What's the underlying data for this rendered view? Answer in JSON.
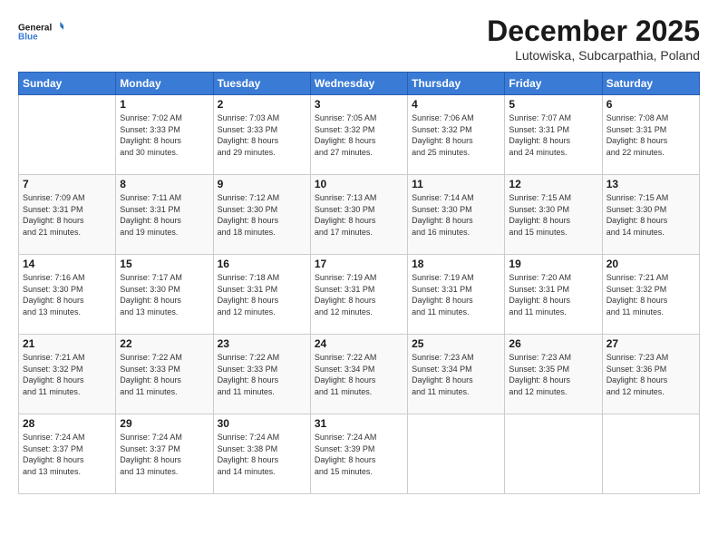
{
  "header": {
    "logo_line1": "General",
    "logo_line2": "Blue",
    "month_title": "December 2025",
    "location": "Lutowiska, Subcarpathia, Poland"
  },
  "days_of_week": [
    "Sunday",
    "Monday",
    "Tuesday",
    "Wednesday",
    "Thursday",
    "Friday",
    "Saturday"
  ],
  "weeks": [
    [
      {
        "day": "",
        "info": ""
      },
      {
        "day": "1",
        "info": "Sunrise: 7:02 AM\nSunset: 3:33 PM\nDaylight: 8 hours\nand 30 minutes."
      },
      {
        "day": "2",
        "info": "Sunrise: 7:03 AM\nSunset: 3:33 PM\nDaylight: 8 hours\nand 29 minutes."
      },
      {
        "day": "3",
        "info": "Sunrise: 7:05 AM\nSunset: 3:32 PM\nDaylight: 8 hours\nand 27 minutes."
      },
      {
        "day": "4",
        "info": "Sunrise: 7:06 AM\nSunset: 3:32 PM\nDaylight: 8 hours\nand 25 minutes."
      },
      {
        "day": "5",
        "info": "Sunrise: 7:07 AM\nSunset: 3:31 PM\nDaylight: 8 hours\nand 24 minutes."
      },
      {
        "day": "6",
        "info": "Sunrise: 7:08 AM\nSunset: 3:31 PM\nDaylight: 8 hours\nand 22 minutes."
      }
    ],
    [
      {
        "day": "7",
        "info": "Sunrise: 7:09 AM\nSunset: 3:31 PM\nDaylight: 8 hours\nand 21 minutes."
      },
      {
        "day": "8",
        "info": "Sunrise: 7:11 AM\nSunset: 3:31 PM\nDaylight: 8 hours\nand 19 minutes."
      },
      {
        "day": "9",
        "info": "Sunrise: 7:12 AM\nSunset: 3:30 PM\nDaylight: 8 hours\nand 18 minutes."
      },
      {
        "day": "10",
        "info": "Sunrise: 7:13 AM\nSunset: 3:30 PM\nDaylight: 8 hours\nand 17 minutes."
      },
      {
        "day": "11",
        "info": "Sunrise: 7:14 AM\nSunset: 3:30 PM\nDaylight: 8 hours\nand 16 minutes."
      },
      {
        "day": "12",
        "info": "Sunrise: 7:15 AM\nSunset: 3:30 PM\nDaylight: 8 hours\nand 15 minutes."
      },
      {
        "day": "13",
        "info": "Sunrise: 7:15 AM\nSunset: 3:30 PM\nDaylight: 8 hours\nand 14 minutes."
      }
    ],
    [
      {
        "day": "14",
        "info": "Sunrise: 7:16 AM\nSunset: 3:30 PM\nDaylight: 8 hours\nand 13 minutes."
      },
      {
        "day": "15",
        "info": "Sunrise: 7:17 AM\nSunset: 3:30 PM\nDaylight: 8 hours\nand 13 minutes."
      },
      {
        "day": "16",
        "info": "Sunrise: 7:18 AM\nSunset: 3:31 PM\nDaylight: 8 hours\nand 12 minutes."
      },
      {
        "day": "17",
        "info": "Sunrise: 7:19 AM\nSunset: 3:31 PM\nDaylight: 8 hours\nand 12 minutes."
      },
      {
        "day": "18",
        "info": "Sunrise: 7:19 AM\nSunset: 3:31 PM\nDaylight: 8 hours\nand 11 minutes."
      },
      {
        "day": "19",
        "info": "Sunrise: 7:20 AM\nSunset: 3:31 PM\nDaylight: 8 hours\nand 11 minutes."
      },
      {
        "day": "20",
        "info": "Sunrise: 7:21 AM\nSunset: 3:32 PM\nDaylight: 8 hours\nand 11 minutes."
      }
    ],
    [
      {
        "day": "21",
        "info": "Sunrise: 7:21 AM\nSunset: 3:32 PM\nDaylight: 8 hours\nand 11 minutes."
      },
      {
        "day": "22",
        "info": "Sunrise: 7:22 AM\nSunset: 3:33 PM\nDaylight: 8 hours\nand 11 minutes."
      },
      {
        "day": "23",
        "info": "Sunrise: 7:22 AM\nSunset: 3:33 PM\nDaylight: 8 hours\nand 11 minutes."
      },
      {
        "day": "24",
        "info": "Sunrise: 7:22 AM\nSunset: 3:34 PM\nDaylight: 8 hours\nand 11 minutes."
      },
      {
        "day": "25",
        "info": "Sunrise: 7:23 AM\nSunset: 3:34 PM\nDaylight: 8 hours\nand 11 minutes."
      },
      {
        "day": "26",
        "info": "Sunrise: 7:23 AM\nSunset: 3:35 PM\nDaylight: 8 hours\nand 12 minutes."
      },
      {
        "day": "27",
        "info": "Sunrise: 7:23 AM\nSunset: 3:36 PM\nDaylight: 8 hours\nand 12 minutes."
      }
    ],
    [
      {
        "day": "28",
        "info": "Sunrise: 7:24 AM\nSunset: 3:37 PM\nDaylight: 8 hours\nand 13 minutes."
      },
      {
        "day": "29",
        "info": "Sunrise: 7:24 AM\nSunset: 3:37 PM\nDaylight: 8 hours\nand 13 minutes."
      },
      {
        "day": "30",
        "info": "Sunrise: 7:24 AM\nSunset: 3:38 PM\nDaylight: 8 hours\nand 14 minutes."
      },
      {
        "day": "31",
        "info": "Sunrise: 7:24 AM\nSunset: 3:39 PM\nDaylight: 8 hours\nand 15 minutes."
      },
      {
        "day": "",
        "info": ""
      },
      {
        "day": "",
        "info": ""
      },
      {
        "day": "",
        "info": ""
      }
    ]
  ]
}
